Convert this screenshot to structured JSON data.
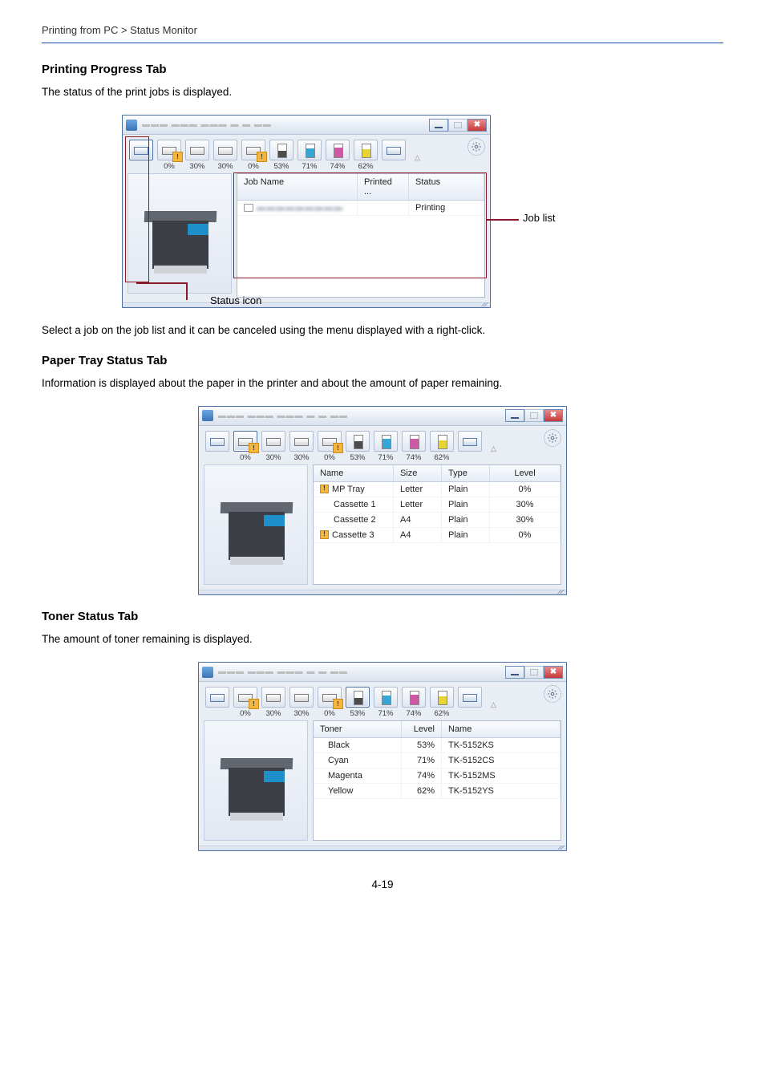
{
  "breadcrumb": "Printing from PC > Status Monitor",
  "section1": {
    "title": "Printing Progress Tab",
    "desc": "The status of the print jobs is displayed.",
    "after": "Select a job on the job list and it can be canceled using the menu displayed with a right-click.",
    "callout_joblist": "Job list",
    "callout_status": "Status icon"
  },
  "section2": {
    "title": "Paper Tray Status Tab",
    "desc": "Information is displayed about the paper in the printer and about the amount of paper remaining."
  },
  "section3": {
    "title": "Toner Status Tab",
    "desc": "The amount of toner remaining is displayed."
  },
  "toolbar_pct": [
    "0%",
    "30%",
    "30%",
    "0%",
    "53%",
    "71%",
    "74%",
    "62%"
  ],
  "win1": {
    "headers": [
      "Job Name",
      "Printed ...",
      "Status"
    ],
    "row": {
      "status": "Printing"
    }
  },
  "win2": {
    "headers": [
      "Name",
      "Size",
      "Type",
      "Level"
    ],
    "rows": [
      {
        "name": "MP Tray",
        "warn": true,
        "size": "Letter",
        "type": "Plain",
        "level": "0%"
      },
      {
        "name": "Cassette 1",
        "warn": false,
        "size": "Letter",
        "type": "Plain",
        "level": "30%"
      },
      {
        "name": "Cassette 2",
        "warn": false,
        "size": "A4",
        "type": "Plain",
        "level": "30%"
      },
      {
        "name": "Cassette 3",
        "warn": true,
        "size": "A4",
        "type": "Plain",
        "level": "0%"
      }
    ]
  },
  "win3": {
    "headers": [
      "Toner",
      "Level",
      "Name"
    ],
    "rows": [
      {
        "toner": "Black",
        "level": "53%",
        "name": "TK-5152KS"
      },
      {
        "toner": "Cyan",
        "level": "71%",
        "name": "TK-5152CS"
      },
      {
        "toner": "Magenta",
        "level": "74%",
        "name": "TK-5152MS"
      },
      {
        "toner": "Yellow",
        "level": "62%",
        "name": "TK-5152YS"
      }
    ]
  },
  "page_number": "4-19"
}
